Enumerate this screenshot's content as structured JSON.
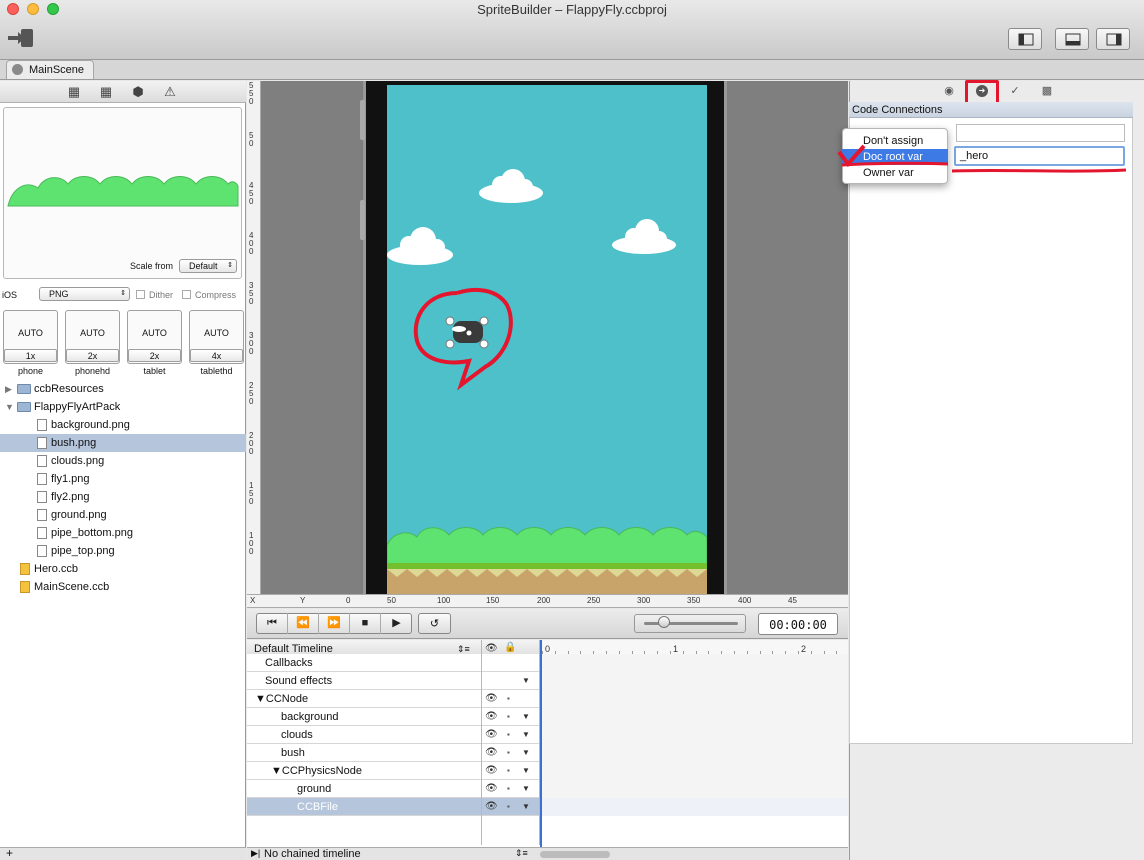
{
  "window": {
    "title": "SpriteBuilder – FlappyFly.ccbproj",
    "traffic_colors": [
      "#fc605c",
      "#fdbc40",
      "#34c84a"
    ]
  },
  "tabs": [
    {
      "label": "MainScene"
    }
  ],
  "left_panel": {
    "scale_from_label": "Scale from",
    "scale_from_value": "Default",
    "platform_label": "iOS",
    "format_value": "PNG",
    "dither_label": "Dither",
    "compress_label": "Compress",
    "resolutions": [
      {
        "value": "AUTO",
        "scale": "1x",
        "name": "phone"
      },
      {
        "value": "AUTO",
        "scale": "2x",
        "name": "phonehd"
      },
      {
        "value": "AUTO",
        "scale": "2x",
        "name": "tablet"
      },
      {
        "value": "AUTO",
        "scale": "4x",
        "name": "tablethd"
      }
    ],
    "tree": [
      {
        "label": "ccbResources",
        "type": "folder",
        "level": 0,
        "collapsed": true
      },
      {
        "label": "FlappyFlyArtPack",
        "type": "folder",
        "level": 0,
        "collapsed": false
      },
      {
        "label": "background.png",
        "type": "file",
        "level": 1
      },
      {
        "label": "bush.png",
        "type": "file",
        "level": 1,
        "selected": true
      },
      {
        "label": "clouds.png",
        "type": "file",
        "level": 1
      },
      {
        "label": "fly1.png",
        "type": "file",
        "level": 1
      },
      {
        "label": "fly2.png",
        "type": "file",
        "level": 1
      },
      {
        "label": "ground.png",
        "type": "file",
        "level": 1
      },
      {
        "label": "pipe_bottom.png",
        "type": "file",
        "level": 1
      },
      {
        "label": "pipe_top.png",
        "type": "file",
        "level": 1
      },
      {
        "label": "Hero.ccb",
        "type": "ccb",
        "level": 0
      },
      {
        "label": "MainScene.ccb",
        "type": "ccb",
        "level": 0
      }
    ]
  },
  "stage": {
    "h_ruler_labels": [
      "X",
      "Y",
      "0",
      "50",
      "100",
      "150",
      "200",
      "250",
      "300",
      "350",
      "400",
      "45"
    ],
    "v_ruler_labels": [
      "5\n5\n0",
      "5\n0",
      "4\n5\n0",
      "4\n0\n0",
      "3\n5\n0",
      "3\n0\n0",
      "2\n5\n0",
      "2\n0\n0",
      "1\n5\n0",
      "1\n0\n0"
    ],
    "colors": {
      "sky": "#4ec0ca",
      "bush": "#5ee270",
      "ground": "#ded895",
      "annotation": "#e3162e"
    }
  },
  "transport": {
    "buttons": [
      "⏮",
      "⏪",
      "⏩",
      "■",
      "▶"
    ],
    "loop": "↺",
    "time": "00:00:00"
  },
  "timeline": {
    "header_label": "Default Timeline",
    "ticks": [
      "0",
      "1",
      "2"
    ],
    "rows": [
      {
        "label": "Callbacks",
        "indent": 0
      },
      {
        "label": "Sound effects",
        "indent": 0
      },
      {
        "label": "▼CCNode",
        "indent": 0
      },
      {
        "label": "background",
        "indent": 1
      },
      {
        "label": "clouds",
        "indent": 1
      },
      {
        "label": "bush",
        "indent": 1
      },
      {
        "label": "▼CCPhysicsNode",
        "indent": 1
      },
      {
        "label": "ground",
        "indent": 2
      },
      {
        "label": "CCBFile",
        "indent": 2,
        "selected": true
      }
    ],
    "chained": "No chained timeline"
  },
  "inspector": {
    "section_title": "Code Connections",
    "dropdown_options": [
      "Don't assign",
      "Doc root var",
      "Owner var"
    ],
    "selected_option": "Doc root var",
    "var_name": "_hero"
  }
}
